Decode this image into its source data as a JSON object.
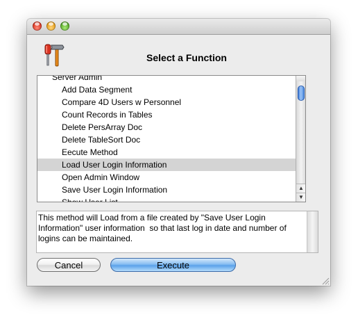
{
  "window": {
    "heading": "Select a Function"
  },
  "function_list": {
    "items": [
      {
        "label": "Server Admin",
        "group": true
      },
      {
        "label": "Add Data Segment"
      },
      {
        "label": "Compare 4D Users w Personnel"
      },
      {
        "label": "Count Records in Tables"
      },
      {
        "label": "Delete PersArray Doc"
      },
      {
        "label": "Delete TableSort Doc"
      },
      {
        "label": "Eecute Method"
      },
      {
        "label": "Load User Login Information",
        "selected": true
      },
      {
        "label": "Open Admin Window"
      },
      {
        "label": "Save User Login Information"
      },
      {
        "label": "Show User List"
      }
    ],
    "scroll_up_glyph": "▲",
    "scroll_down_glyph": "▼"
  },
  "description": {
    "text": "This method will Load from a file created by \"Save User Login Information\" user information  so that last log in date and number of logins can be maintained."
  },
  "buttons": {
    "cancel_label": "Cancel",
    "execute_label": "Execute"
  },
  "icons": {
    "app": "tools-icon",
    "resize": "resize-grip-icon"
  },
  "colors": {
    "selection": "#d4d4d4",
    "default_button": "#5aa2ea",
    "scroll_thumb": "#2d6fd4"
  }
}
